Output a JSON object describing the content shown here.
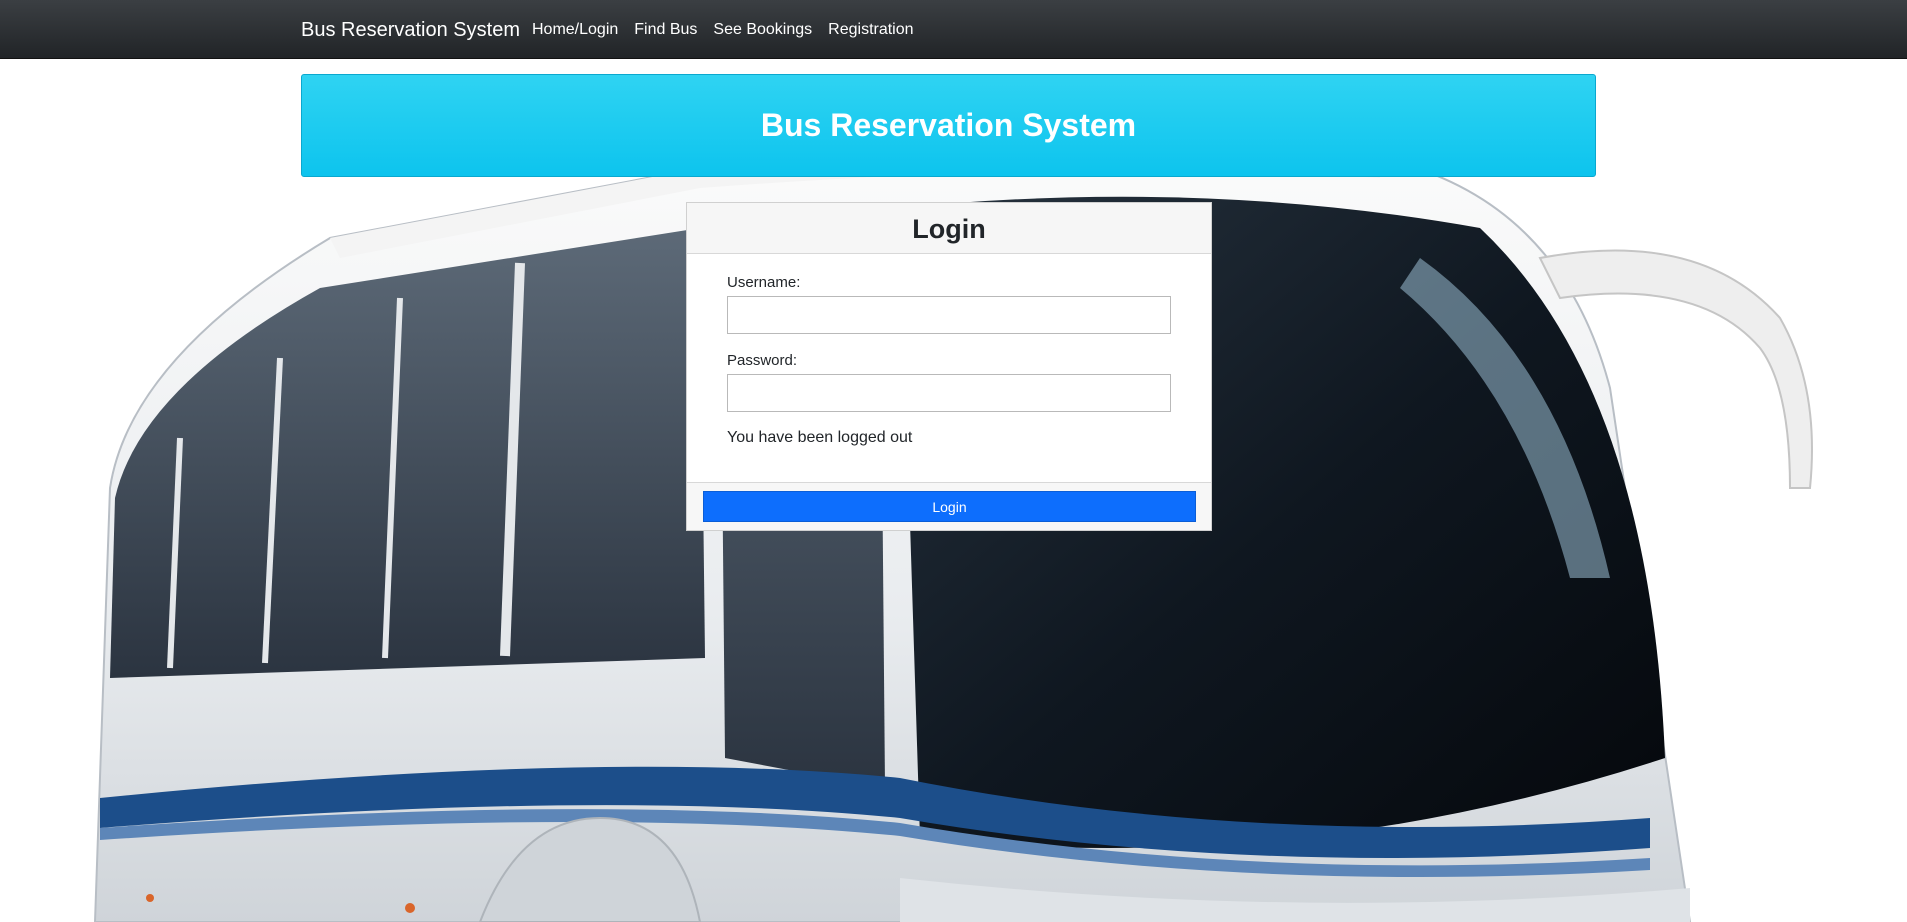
{
  "navbar": {
    "brand": "Bus Reservation System",
    "links": [
      "Home/Login",
      "Find Bus",
      "See Bookings",
      "Registration"
    ]
  },
  "banner": {
    "title": "Bus Reservation System"
  },
  "login": {
    "title": "Login",
    "username_label": "Username:",
    "username_value": "",
    "password_label": "Password:",
    "password_value": "",
    "message": "You have been logged out",
    "submit_label": "Login"
  },
  "colors": {
    "navbar": "#212427",
    "banner": "#0dcaf0",
    "primary_button": "#0d6efd"
  }
}
